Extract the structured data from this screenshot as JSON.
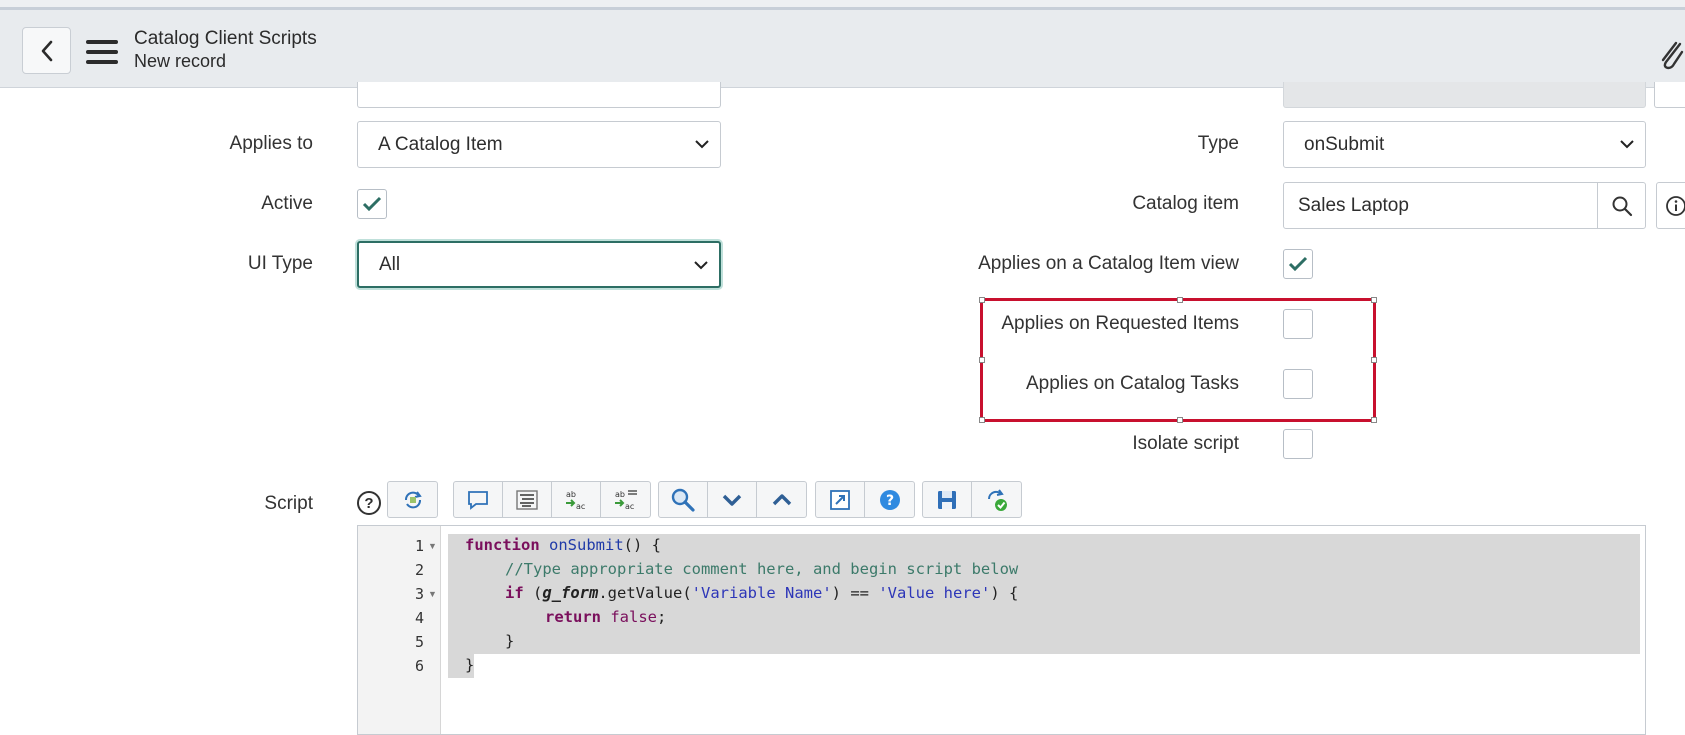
{
  "header": {
    "title": "Catalog Client Scripts",
    "subtitle": "New record"
  },
  "form": {
    "applies_to": {
      "label": "Applies to",
      "value": "A Catalog Item"
    },
    "active": {
      "label": "Active",
      "checked": true
    },
    "ui_type": {
      "label": "UI Type",
      "value": "All"
    },
    "type": {
      "label": "Type",
      "value": "onSubmit"
    },
    "catalog_item": {
      "label": "Catalog item",
      "value": "Sales Laptop"
    },
    "applies_catalog_item_view": {
      "label": "Applies on a Catalog Item view",
      "checked": true
    },
    "applies_requested_items": {
      "label": "Applies on Requested Items",
      "checked": false
    },
    "applies_catalog_tasks": {
      "label": "Applies on Catalog Tasks",
      "checked": false
    },
    "isolate_script": {
      "label": "Isolate script",
      "checked": false
    },
    "script": {
      "label": "Script"
    }
  },
  "toolbar": {
    "help_glyph": "?",
    "icons": [
      "script-sync-icon",
      "comment-icon",
      "format-icon",
      "replace-icon",
      "replace-all-icon",
      "search-icon",
      "find-next-icon",
      "find-previous-icon",
      "fullscreen-icon",
      "help-icon",
      "save-icon",
      "script-check-icon"
    ]
  },
  "editor": {
    "line_numbers": [
      "1",
      "2",
      "3",
      "4",
      "5",
      "6"
    ],
    "lines": {
      "l1_kw": "function",
      "l1_fn": "onSubmit",
      "l1_rest": "() {",
      "l2_comment": "//Type appropriate comment here, and begin script below",
      "l3_kw": "if",
      "l3_open": " (",
      "l3_obj": "g_form",
      "l3_method": ".getValue(",
      "l3_str1": "'Variable Name'",
      "l3_op": ") == ",
      "l3_str2": "'Value here'",
      "l3_close": ") {",
      "l4_kw": "return",
      "l4_bool": "false",
      "l4_end": ";",
      "l5": "}",
      "l6": "}"
    }
  },
  "colors": {
    "accent": "#2d6e64",
    "highlight_border": "#c8102e"
  }
}
